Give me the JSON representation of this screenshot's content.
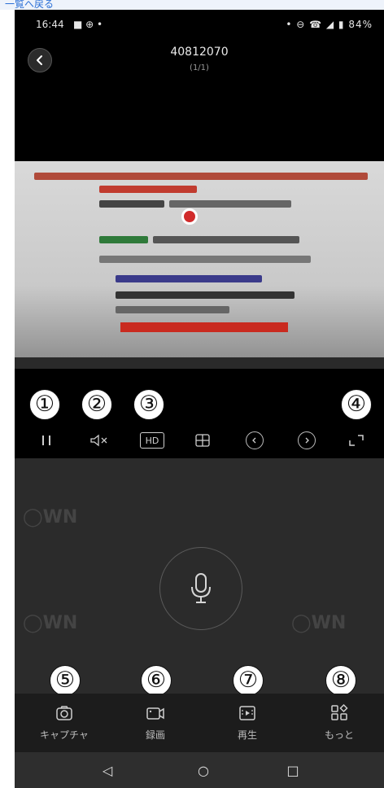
{
  "top_link": "一覧へ戻る",
  "status": {
    "time": "16:44",
    "left_icons": "■ ⊕ •",
    "right_icons": "• ⊖ ☎ ◢ ▮ 84%"
  },
  "header": {
    "title": "40812070",
    "subtitle": "(1/1)"
  },
  "callouts": [
    "①",
    "②",
    "③",
    "④",
    "⑤",
    "⑥",
    "⑦",
    "⑧"
  ],
  "controls": {
    "pause": "| |",
    "mute": "◁×",
    "hd": "HD",
    "split": "⊞",
    "prev": "‹",
    "next": "›",
    "fullscreen": "⌞⌝"
  },
  "tabs": [
    {
      "icon": "camera-icon",
      "label": "キャプチャ"
    },
    {
      "icon": "video-record-icon",
      "label": "録画"
    },
    {
      "icon": "playback-icon",
      "label": "再生"
    },
    {
      "icon": "more-icon",
      "label": "もっと"
    }
  ],
  "nav": {
    "back": "◁",
    "home": "○",
    "recent": "□"
  }
}
